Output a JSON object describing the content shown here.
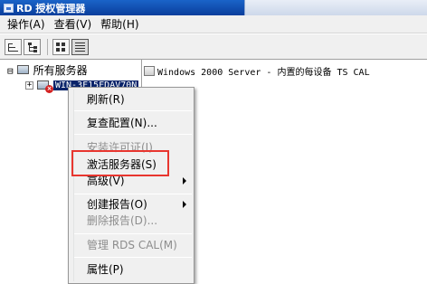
{
  "window": {
    "title": "RD 授权管理器"
  },
  "menubar": {
    "items": [
      "操作(A)",
      "查看(V)",
      "帮助(H)"
    ]
  },
  "toolbar": {
    "icons": [
      "back-forward-icon",
      "tree-icon",
      "detail-view-icon",
      "list-view-icon"
    ]
  },
  "tree": {
    "root_label": "所有服务器",
    "root_expander": "⊟",
    "server_label": "WIN-3F15FDAV70N",
    "server_expander": "+"
  },
  "list": {
    "items": [
      {
        "text": "Windows 2000 Server - 内置的每设备 TS  CAL"
      }
    ]
  },
  "context_menu": {
    "refresh": "刷新(R)",
    "review_config": "复查配置(N)...",
    "install_licenses": "安装许可证(I)",
    "activate_server": "激活服务器(S)",
    "advanced": "高级(V)",
    "create_report": "创建报告(O)",
    "delete_report": "删除报告(D)...",
    "manage_rds_cal": "管理 RDS CAL(M)",
    "properties": "属性(P)"
  },
  "colors": {
    "highlight_box": "#e8362f",
    "title_bar": "#0a3e9c",
    "selection": "#0a246a"
  }
}
